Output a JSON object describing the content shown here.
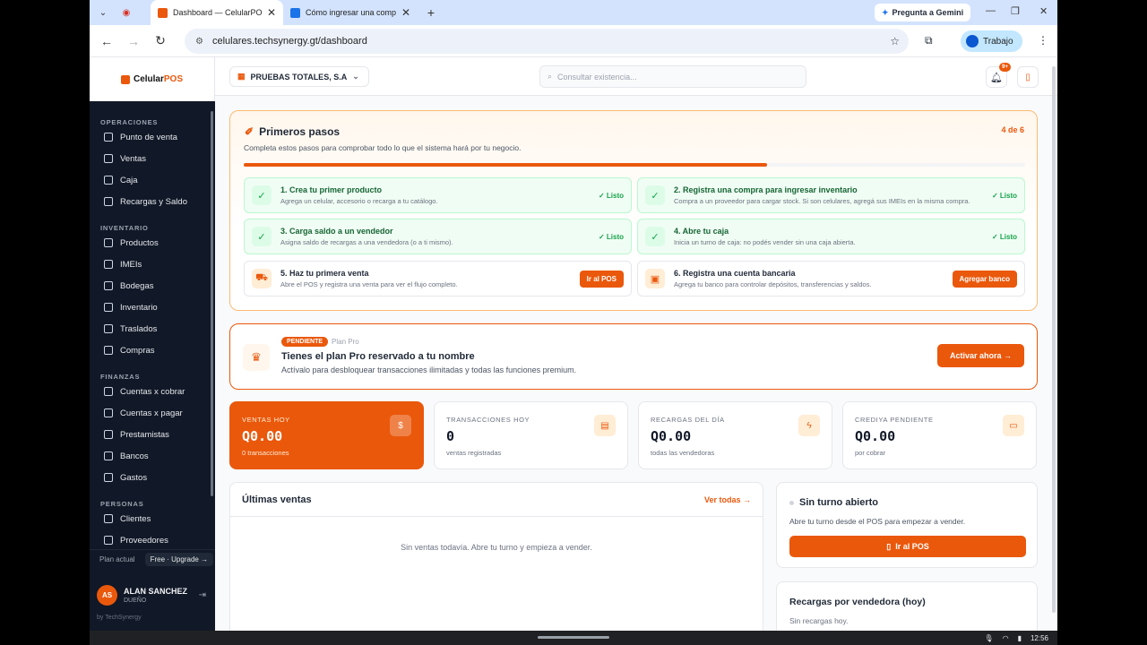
{
  "browser": {
    "tabs": [
      {
        "title": "Dashboard — CelularPOS",
        "active": true
      },
      {
        "title": "Cómo ingresar una comp",
        "active": false
      }
    ],
    "gemini_label": "Pregunta a Gemini",
    "url": "celulares.techsynergy.gt/dashboard",
    "profile_label": "Trabajo"
  },
  "sidebar": {
    "logo": {
      "brand": "Celular",
      "brand_accent": "POS"
    },
    "sections": [
      {
        "title": "OPERACIONES",
        "items": [
          "Punto de venta",
          "Ventas",
          "Caja",
          "Recargas y Saldo"
        ]
      },
      {
        "title": "INVENTARIO",
        "items": [
          "Productos",
          "IMEIs",
          "Bodegas",
          "Inventario",
          "Traslados",
          "Compras"
        ]
      },
      {
        "title": "FINANZAS",
        "items": [
          "Cuentas x cobrar",
          "Cuentas x pagar",
          "Prestamistas",
          "Bancos",
          "Gastos"
        ]
      },
      {
        "title": "PERSONAS",
        "items": [
          "Clientes",
          "Proveedores"
        ]
      }
    ],
    "plan_label": "Plan actual",
    "plan_button": "Free · Upgrade →",
    "user": {
      "initials": "AS",
      "name": "ALAN SANCHEZ",
      "role": "DUEÑO"
    },
    "byline": "by TechSynergy"
  },
  "topbar": {
    "company": "PRUEBAS TOTALES, S.A",
    "search_placeholder": "Consultar existencia...",
    "notif_badge": "9+"
  },
  "onboarding": {
    "title": "Primeros pasos",
    "subtitle": "Completa estos pasos para comprobar todo lo que el sistema hará por tu negocio.",
    "count": "4 de 6",
    "progress": 0.67,
    "steps": [
      {
        "title": "1. Crea tu primer producto",
        "desc": "Agrega un celular, accesorio o recarga a tu catálogo.",
        "status": "✓ Listo"
      },
      {
        "title": "2. Registra una compra para ingresar inventario",
        "desc": "Compra a un proveedor para cargar stock. Si son celulares, agregá sus IMEIs en la misma compra.",
        "status": "✓ Listo"
      },
      {
        "title": "3. Carga saldo a un vendedor",
        "desc": "Asigna saldo de recargas a una vendedora (o a ti mismo).",
        "status": "✓ Listo"
      },
      {
        "title": "4. Abre tu caja",
        "desc": "Inicia un turno de caja: no podés vender sin una caja abierta.",
        "status": "✓ Listo"
      },
      {
        "title": "5. Haz tu primera venta",
        "desc": "Abre el POS y registra una venta para ver el flujo completo.",
        "button": "Ir al POS"
      },
      {
        "title": "6. Registra una cuenta bancaria",
        "desc": "Agrega tu banco para controlar depósitos, transferencias y saldos.",
        "button": "Agregar banco"
      }
    ]
  },
  "pro": {
    "badge": "PENDIENTE",
    "plan": "Plan Pro",
    "title": "Tienes el plan Pro reservado a tu nombre",
    "subtitle": "Actívalo para desbloquear transacciones ilimitadas y todas las funciones premium.",
    "button": "Activar ahora →"
  },
  "stats": [
    {
      "label": "VENTAS HOY",
      "value": "Q0.00",
      "hint": "0 transacciones",
      "icon": "$"
    },
    {
      "label": "TRANSACCIONES HOY",
      "value": "0",
      "hint": "ventas registradas",
      "icon": "▤"
    },
    {
      "label": "RECARGAS DEL DÍA",
      "value": "Q0.00",
      "hint": "todas las vendedoras",
      "icon": "ϟ"
    },
    {
      "label": "CREDIYA PENDIENTE",
      "value": "Q0.00",
      "hint": "por cobrar",
      "icon": "▭"
    }
  ],
  "sales": {
    "title": "Últimas ventas",
    "link": "Ver todas →",
    "empty": "Sin ventas todavía. Abre tu turno y empieza a vender."
  },
  "shift": {
    "title": "Sin turno abierto",
    "subtitle": "Abre tu turno desde el POS para empezar a vender.",
    "button": "Ir al POS"
  },
  "recharges": {
    "title": "Recargas por vendedora (hoy)",
    "empty": "Sin recargas hoy."
  },
  "os": {
    "time": "12:56"
  }
}
